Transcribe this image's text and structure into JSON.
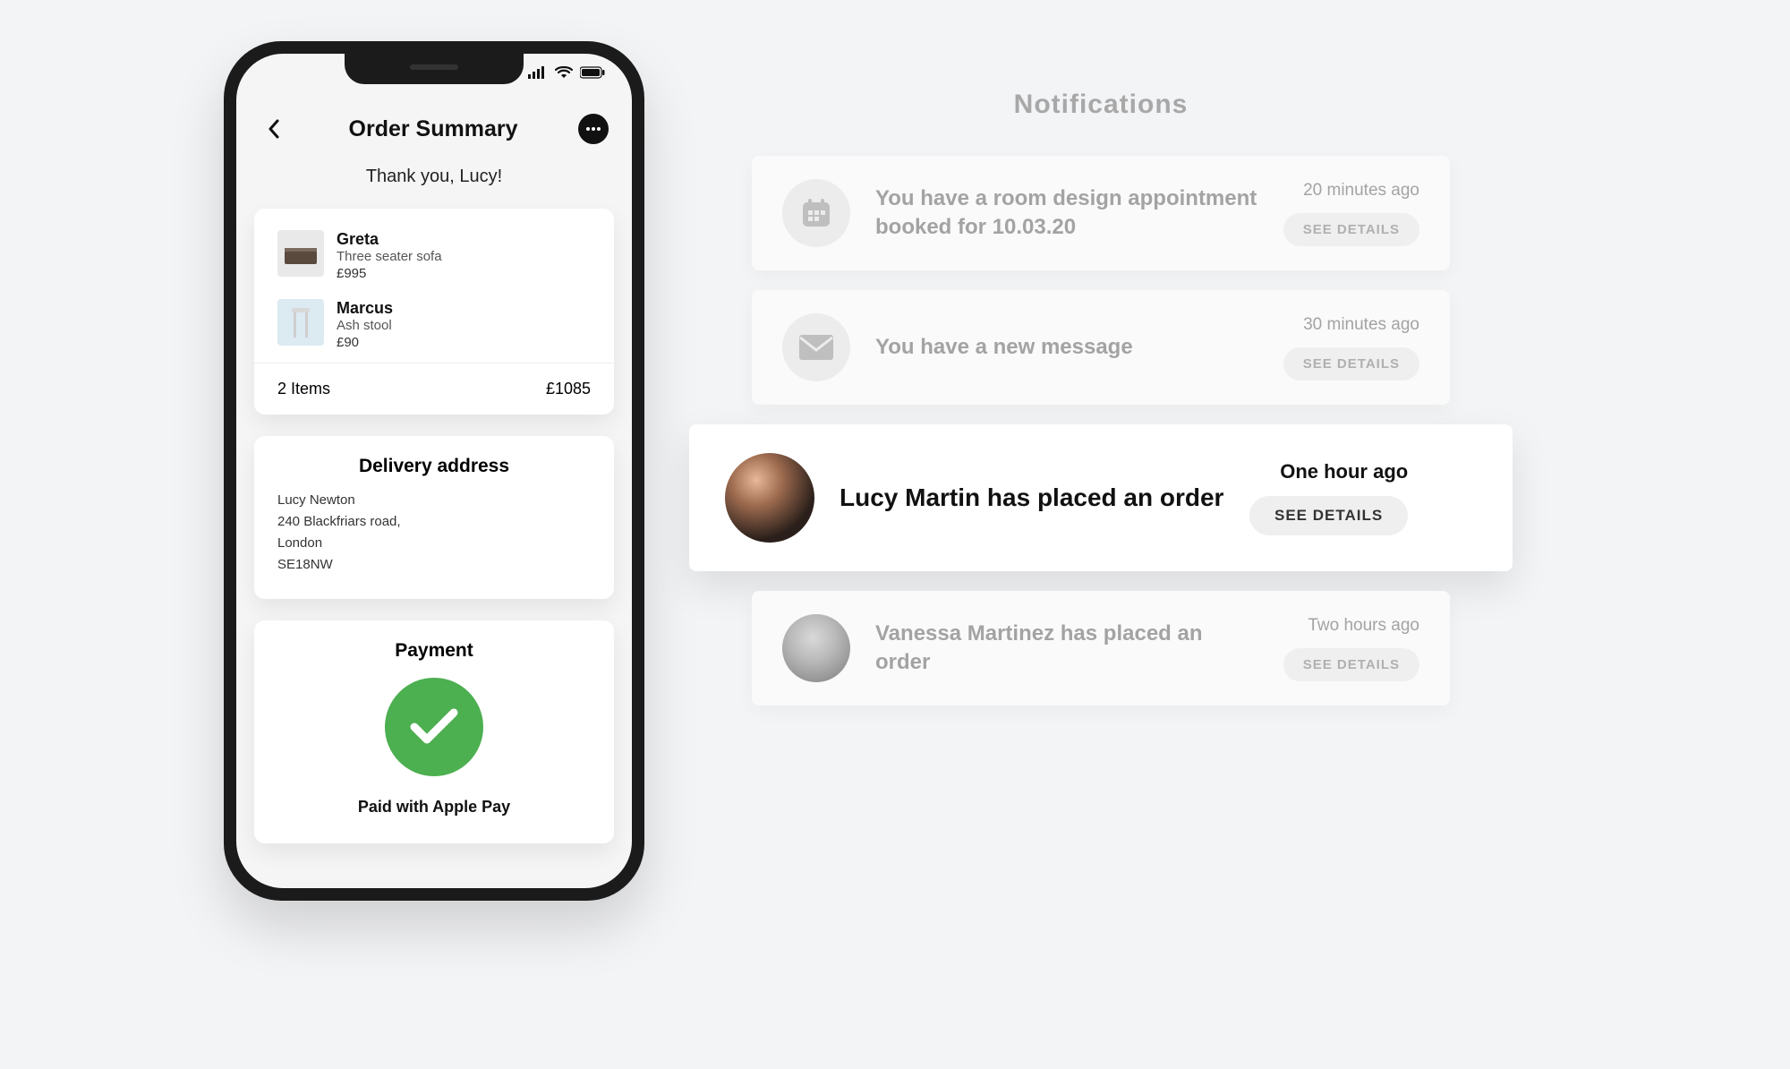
{
  "phone": {
    "header": {
      "title": "Order Summary",
      "back_icon": "chevron-left",
      "more_icon": "more-horizontal"
    },
    "thank_you": "Thank you, Lucy!",
    "items": [
      {
        "name": "Greta",
        "desc": "Three seater sofa",
        "price": "£995",
        "thumb": "sofa"
      },
      {
        "name": "Marcus",
        "desc": "Ash stool",
        "price": "£90",
        "thumb": "stool"
      }
    ],
    "items_footer": {
      "count_label": "2 Items",
      "total": "£1085"
    },
    "delivery": {
      "title": "Delivery address",
      "lines": [
        "Lucy Newton",
        "240 Blackfriars road,",
        "London",
        "SE18NW"
      ]
    },
    "payment": {
      "title": "Payment",
      "status_icon": "check",
      "paid_with": "Paid with Apple Pay"
    }
  },
  "notifications": {
    "title": "Notifications",
    "see_details_label": "SEE DETAILS",
    "items": [
      {
        "icon": "calendar",
        "text": "You have a room design appointment booked for 10.03.20",
        "time": "20 minutes ago",
        "highlight": false
      },
      {
        "icon": "envelope",
        "text": "You have a new message",
        "time": "30 minutes ago",
        "highlight": false
      },
      {
        "icon": "avatar",
        "text": "Lucy Martin has placed an order",
        "time": "One hour ago",
        "highlight": true
      },
      {
        "icon": "avatar-small",
        "text": "Vanessa Martinez has placed an order",
        "time": "Two hours ago",
        "highlight": false
      }
    ]
  }
}
